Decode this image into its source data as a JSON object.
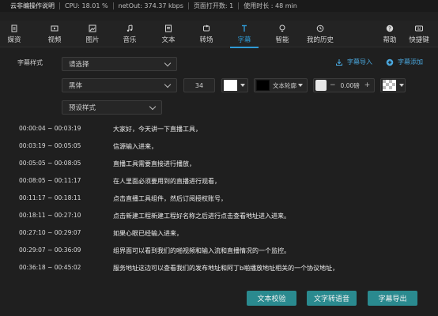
{
  "titlebar": {
    "app_title": "云非编操作说明",
    "cpu": "CPU: 18.01 %",
    "netout": "netOut: 374.37 kbps",
    "pages": "页面打开数: 1",
    "duration": "使用时长 : 48 min"
  },
  "toolbar": {
    "items": [
      {
        "label": "媒资",
        "icon": "media-icon"
      },
      {
        "label": "视频",
        "icon": "video-icon"
      },
      {
        "label": "图片",
        "icon": "image-icon"
      },
      {
        "label": "音乐",
        "icon": "music-icon"
      },
      {
        "label": "文本",
        "icon": "text-icon"
      },
      {
        "label": "转场",
        "icon": "transition-icon"
      },
      {
        "label": "字幕",
        "icon": "subtitle-icon",
        "active": true
      },
      {
        "label": "智能",
        "icon": "bulb-icon"
      },
      {
        "label": "我的历史",
        "icon": "history-icon"
      }
    ],
    "right": [
      {
        "label": "帮助",
        "icon": "help-icon"
      },
      {
        "label": "快捷键",
        "icon": "keyboard-icon"
      }
    ],
    "accent": "#2f9bd6"
  },
  "subtitle_panel": {
    "style_label": "字幕样式",
    "style_select": "请选择",
    "import_label": "字幕导入",
    "add_label": "字幕添加",
    "font_select": "黑体",
    "font_size": "34",
    "text_color": "#ffffff",
    "outline_color": "#000000",
    "outline_label": "文本轮廓",
    "rotation_value": "0.00磅",
    "preset_select": "预设样式"
  },
  "subtitles": [
    {
      "time": "00:00:04 ~ 00:03:19",
      "text": "大家好，今天讲一下直播工具，"
    },
    {
      "time": "00:03:19 ~ 00:05:05",
      "text": "信源输入进来，"
    },
    {
      "time": "00:05:05 ~ 00:08:05",
      "text": "直播工具需要直接进行播放，"
    },
    {
      "time": "00:08:05 ~ 00:11:17",
      "text": "在人里面必须要用到的直播进行观看，"
    },
    {
      "time": "00:11:17 ~ 00:18:11",
      "text": "点击直播工具组件，然后订阅授权账号，"
    },
    {
      "time": "00:18:11 ~ 00:27:10",
      "text": "点击新建工程新建工程好名称之后进行点击查看地址进入进来。"
    },
    {
      "time": "00:27:10 ~ 00:29:07",
      "text": "如果心眼已经输入进来，"
    },
    {
      "time": "00:29:07 ~ 00:36:09",
      "text": "组界面可以看到我们的啪视频和输入流和直播情况的一个监控。"
    },
    {
      "time": "00:36:18 ~ 00:45:02",
      "text": "服务地址这边可以查看我们的发布地址和阿丁b啪播放地址相关的一个协议地址，"
    }
  ],
  "buttons": {
    "check": "文本校验",
    "speech": "文字转语音",
    "export": "字幕导出",
    "color": "#2a8a8f"
  }
}
